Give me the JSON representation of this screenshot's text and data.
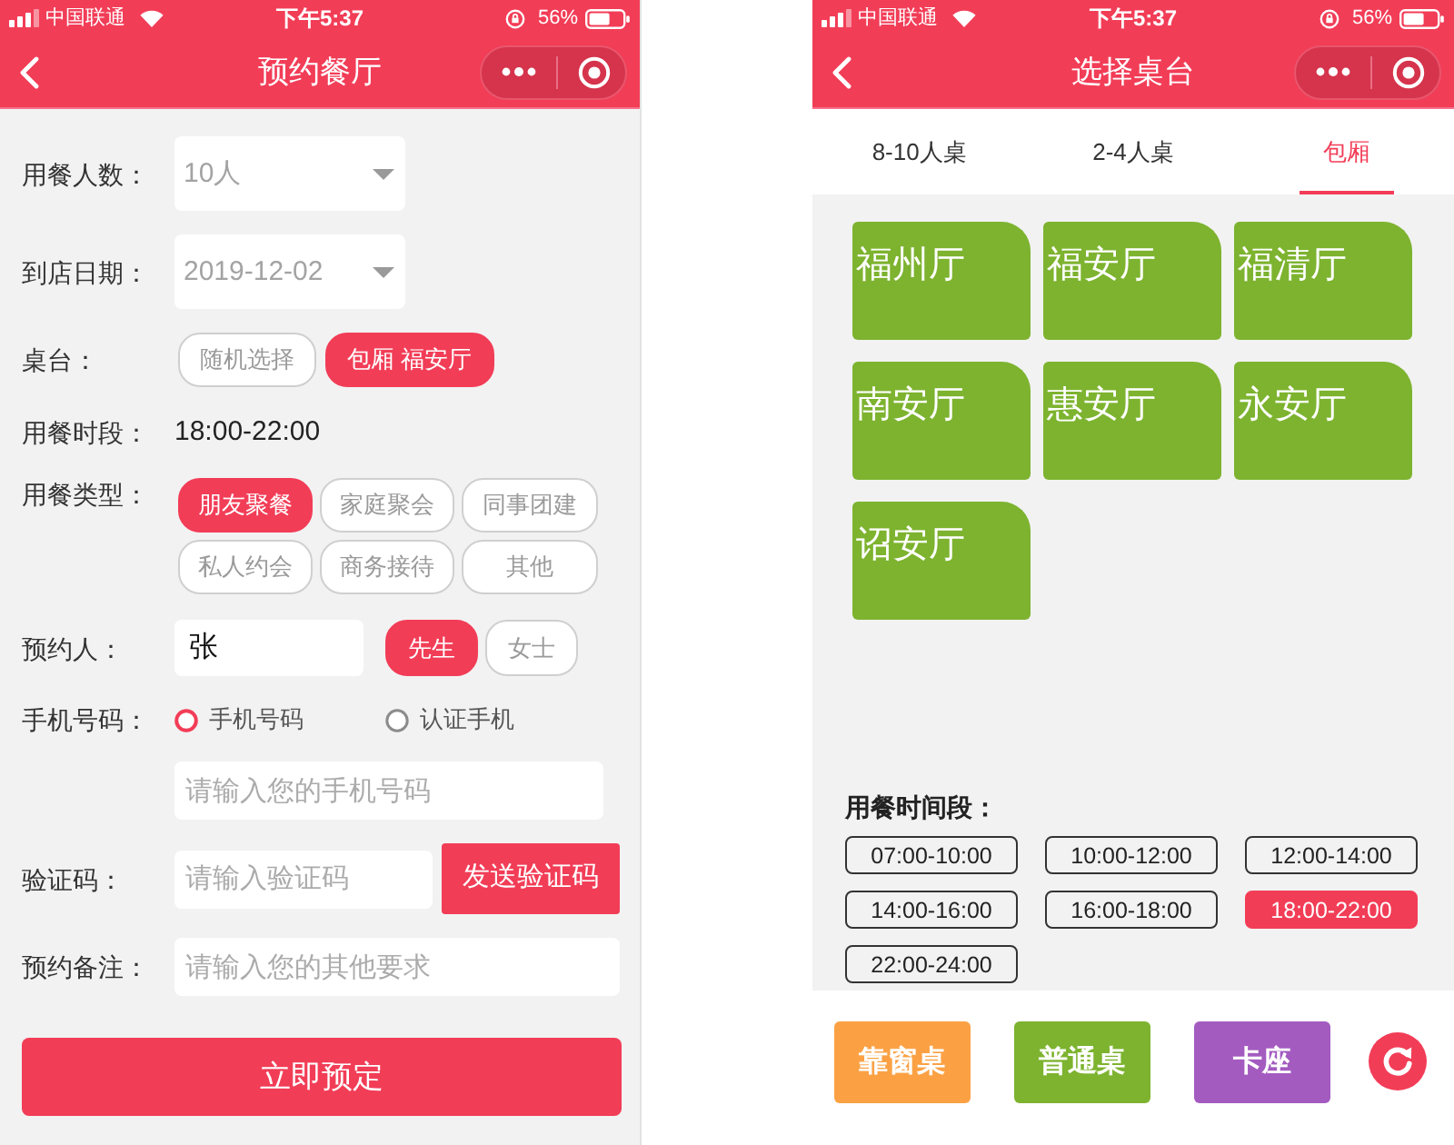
{
  "booking_screen": {
    "status_bar": {
      "carrier": "中国联通",
      "time": "下午5:37",
      "battery": "56%"
    },
    "title": "预约餐厅",
    "form": [
      {
        "kind": "select",
        "label": "用餐人数：",
        "value": "10人"
      },
      {
        "kind": "select",
        "label": "到店日期：",
        "value": "2019-12-02"
      },
      {
        "kind": "buttons",
        "label": "桌台：",
        "options": [
          {
            "label": "随机选择",
            "selected": false
          },
          {
            "label": "包厢 福安厅",
            "selected": true
          }
        ]
      },
      {
        "kind": "text",
        "label": "用餐时段：",
        "value": "18:00-22:00"
      },
      {
        "kind": "grid",
        "label": "用餐类型：",
        "options": [
          {
            "label": "朋友聚餐",
            "selected": true
          },
          {
            "label": "家庭聚会",
            "selected": false
          },
          {
            "label": "同事团建",
            "selected": false
          },
          {
            "label": "私人约会",
            "selected": false
          },
          {
            "label": "商务接待",
            "selected": false
          },
          {
            "label": "其他",
            "selected": false
          }
        ]
      },
      {
        "kind": "name",
        "label": "预约人：",
        "value": "张",
        "options": [
          {
            "label": "先生",
            "selected": true
          },
          {
            "label": "女士",
            "selected": false
          }
        ]
      },
      {
        "kind": "radios",
        "label": "手机号码：",
        "options": [
          {
            "label": "手机号码",
            "selected": true
          },
          {
            "label": "认证手机",
            "selected": false
          }
        ]
      },
      {
        "kind": "input",
        "placeholder": "请输入您的手机号码"
      },
      {
        "kind": "code",
        "label": "验证码：",
        "placeholder": "请输入验证码",
        "button": "发送验证码"
      },
      {
        "kind": "input",
        "label": "预约备注：",
        "placeholder": "请输入您的其他要求"
      }
    ],
    "submit": "立即预定"
  },
  "table_screen": {
    "status_bar": {
      "carrier": "中国联通",
      "time": "下午5:37",
      "battery": "56%"
    },
    "title": "选择桌台",
    "tabs": [
      {
        "label": "8-10人桌",
        "selected": false
      },
      {
        "label": "2-4人桌",
        "selected": false
      },
      {
        "label": "包厢",
        "selected": true
      }
    ],
    "rooms": [
      "福州厅",
      "福安厅",
      "福清厅",
      "南安厅",
      "惠安厅",
      "永安厅",
      "诏安厅"
    ],
    "time_slots_label": "用餐时间段：",
    "time_slots": [
      {
        "label": "07:00-10:00",
        "selected": false
      },
      {
        "label": "10:00-12:00",
        "selected": false
      },
      {
        "label": "12:00-14:00",
        "selected": false
      },
      {
        "label": "14:00-16:00",
        "selected": false
      },
      {
        "label": "16:00-18:00",
        "selected": false
      },
      {
        "label": "18:00-22:00",
        "selected": true
      },
      {
        "label": "22:00-24:00",
        "selected": false
      }
    ],
    "table_types": [
      {
        "label": "靠窗桌",
        "color": "#fba144"
      },
      {
        "label": "普通桌",
        "color": "#7db32f"
      },
      {
        "label": "卡座",
        "color": "#a35bc0"
      }
    ]
  }
}
